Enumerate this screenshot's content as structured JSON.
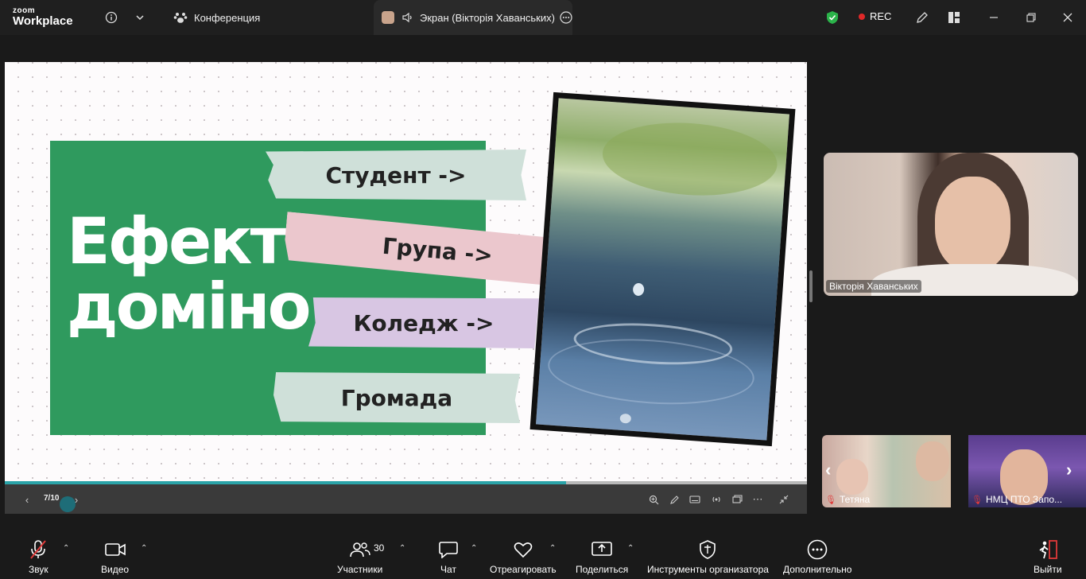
{
  "titlebar": {
    "logo_top": "zoom",
    "logo_bottom": "Workplace",
    "tab_conference": "Конференция",
    "tab_screen": "Экран (Вікторія Хаванських)",
    "rec_label": "REC"
  },
  "slide": {
    "title_line1": "Ефект",
    "title_line2": "доміно",
    "tape1": "Студент ->",
    "tape2": "Група ->",
    "tape3": "Коледж ->",
    "tape4": "Громада",
    "page": "7/10",
    "progress": 0.7,
    "colors": {
      "green": "#2f9a5e",
      "progress": "#2aa3a8"
    }
  },
  "participants": {
    "main_name": "Вікторія Хаванських",
    "thumb1_name": "Тетяна",
    "thumb2_name": "НМЦ ПТО Запо..."
  },
  "toolbar": {
    "audio": "Звук",
    "video": "Видео",
    "participants": "Участники",
    "participants_count": "30",
    "chat": "Чат",
    "react": "Отреагировать",
    "share": "Поделиться",
    "host_tools": "Инструменты организатора",
    "more": "Дополнительно",
    "leave": "Выйти"
  }
}
